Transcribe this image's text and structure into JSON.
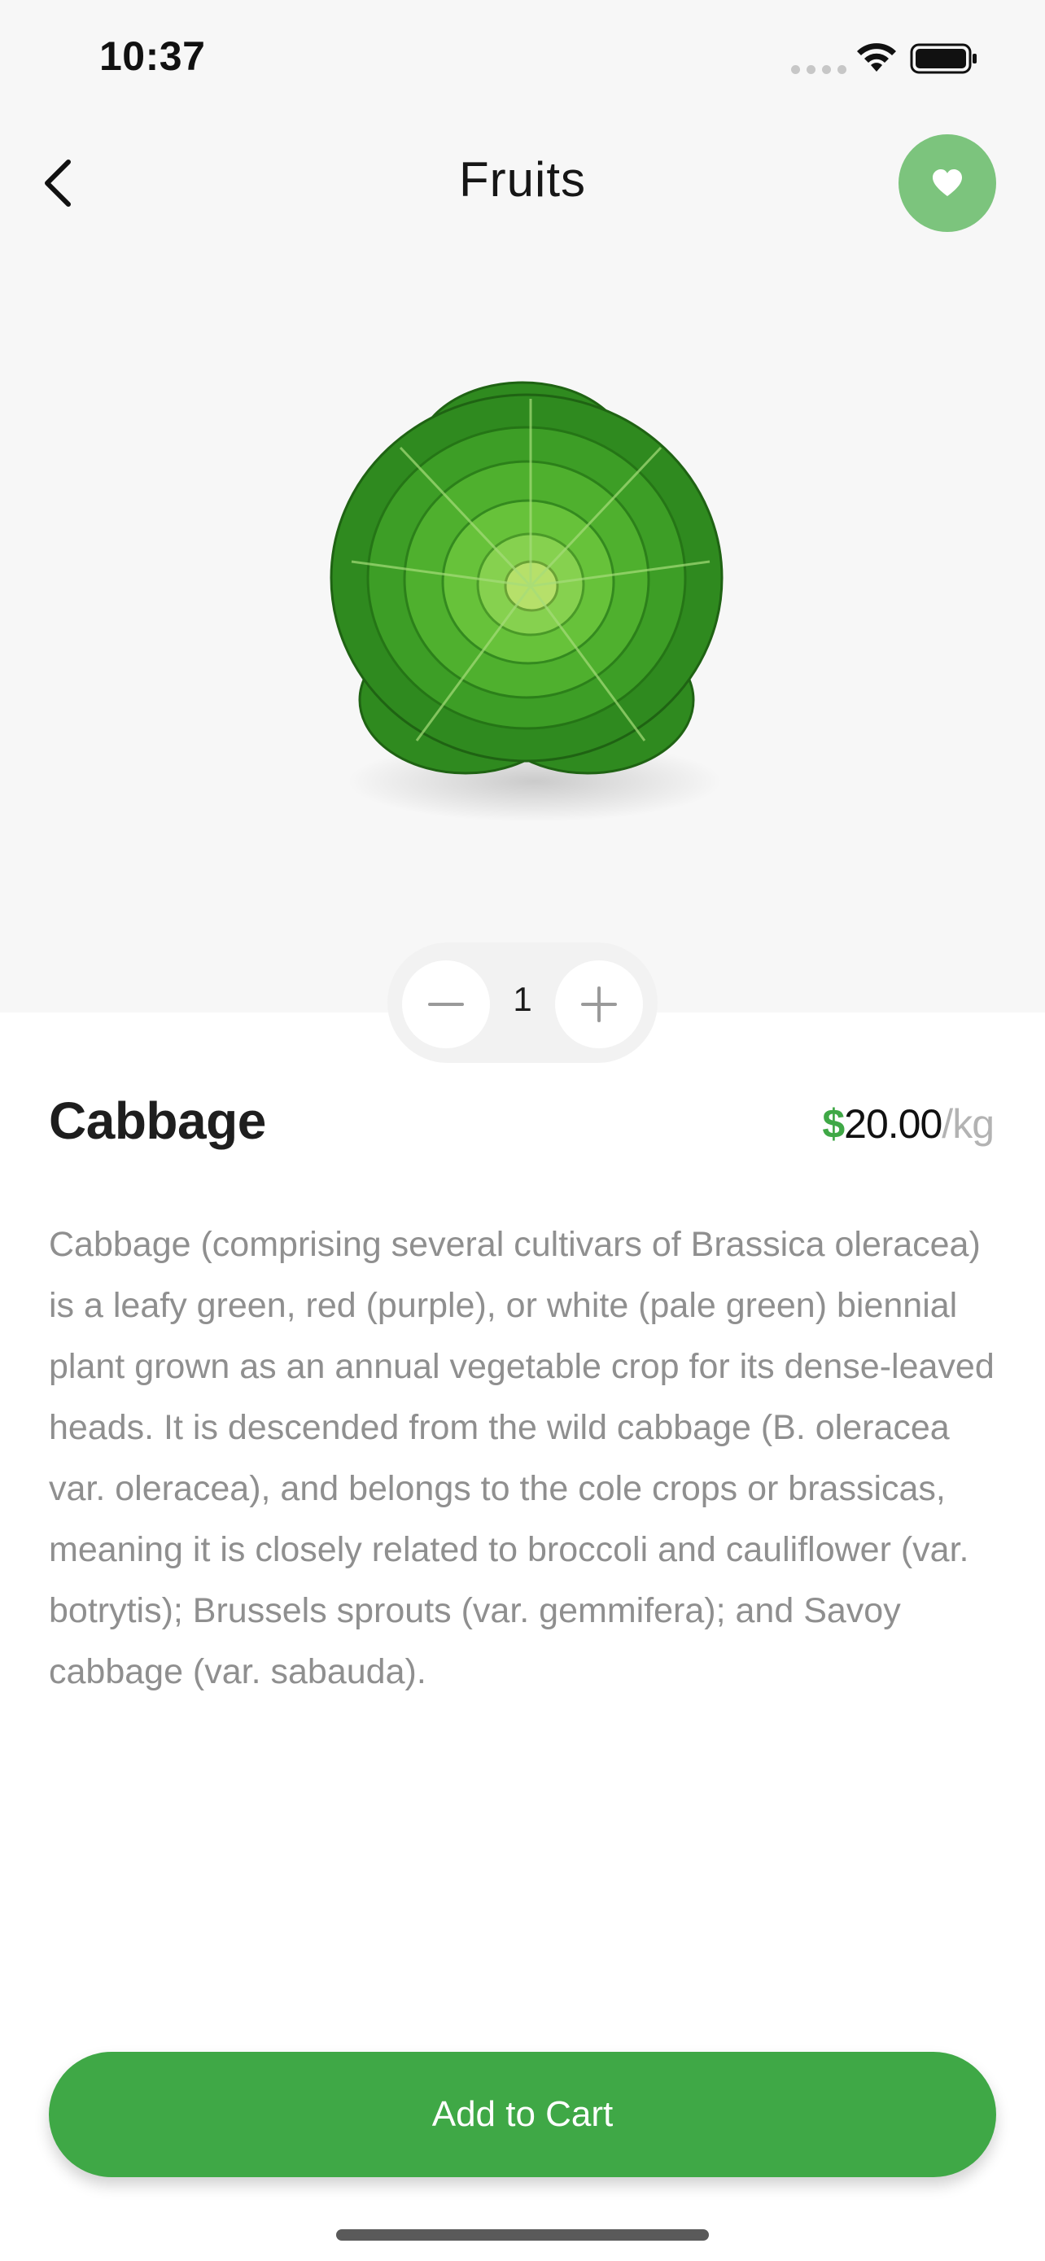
{
  "status_bar": {
    "time": "10:37"
  },
  "header": {
    "title": "Fruits",
    "back_icon": "chevron-left-icon",
    "favorite_icon": "heart-icon"
  },
  "product": {
    "image_alt": "cabbage-image",
    "name": "Cabbage",
    "price_currency": "$",
    "price_amount": "20.00",
    "price_unit": "/kg",
    "quantity": "1",
    "description": "Cabbage (comprising several cultivars of Brassica oleracea) is a leafy green, red (purple), or white (pale green) biennial plant grown as an annual vegetable crop for its dense-leaved heads. It is descended from the wild cabbage (B. oleracea var. oleracea), and belongs to the cole crops or brassicas, meaning it is closely related to broccoli and cauliflower (var. botrytis); Brussels sprouts (var. gemmifera); and Savoy cabbage (var. sabauda)."
  },
  "actions": {
    "add_to_cart_label": "Add to Cart"
  },
  "colors": {
    "accent": "#3fa846",
    "favorite_bg": "#7cc47d",
    "hero_bg": "#f7f7f7",
    "description_text": "#8f8f8f"
  }
}
